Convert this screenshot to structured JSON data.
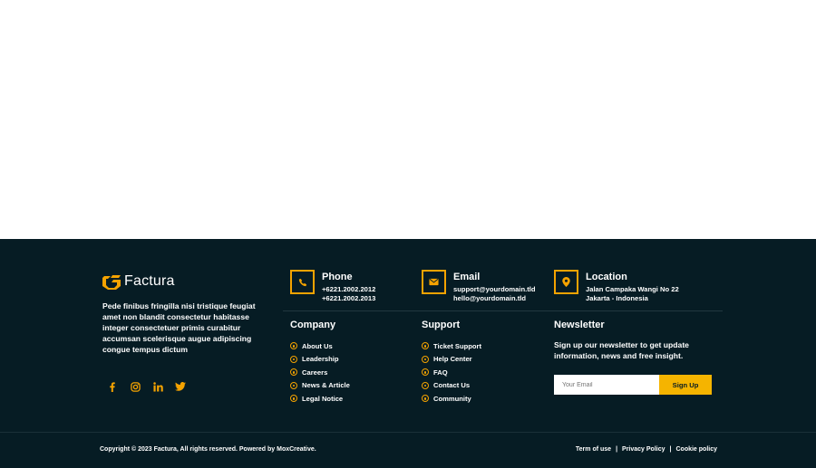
{
  "brand": {
    "name": "Factura",
    "about": "Pede finibus fringilla nisi tristique feugiat amet non blandit consectetur habitasse integer consectetuer primis curabitur accumsan scelerisque augue adipiscing congue tempus dictum"
  },
  "social": [
    "facebook-icon",
    "instagram-icon",
    "linkedin-icon",
    "twitter-icon"
  ],
  "contact": {
    "phone": {
      "title": "Phone",
      "lines": [
        "+6221.2002.2012",
        "+6221.2002.2013"
      ]
    },
    "email": {
      "title": "Email",
      "lines": [
        "support@yourdomain.tld",
        "hello@yourdomain.tld"
      ]
    },
    "location": {
      "title": "Location",
      "lines": [
        "Jalan Campaka Wangi No 22",
        "Jakarta - Indonesia"
      ]
    }
  },
  "company": {
    "title": "Company",
    "items": [
      "About Us",
      "Leadership",
      "Careers",
      "News & Article",
      "Legal Notice"
    ]
  },
  "support": {
    "title": "Support",
    "items": [
      "Ticket Support",
      "Help Center",
      "FAQ",
      "Contact Us",
      "Community"
    ]
  },
  "newsletter": {
    "title": "Newsletter",
    "text": "Sign up our newsletter to get update information, news and free insight.",
    "placeholder": "Your Email",
    "button": "Sign Up"
  },
  "bottom": {
    "copyright": "Copyright © 2023 Factura, All rights reserved. Powered by MoxCreative.",
    "links": [
      "Term of use",
      "Privacy Policy",
      "Cookie policy"
    ],
    "separator": "|"
  },
  "colors": {
    "accent": "#f5a300",
    "background": "#061c24"
  }
}
